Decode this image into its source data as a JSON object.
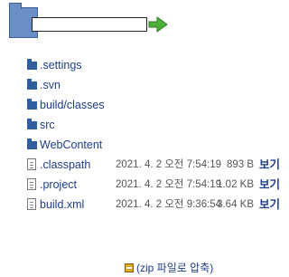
{
  "path": {
    "value": ""
  },
  "entries": [
    {
      "type": "folder",
      "name": ".settings"
    },
    {
      "type": "folder",
      "name": ".svn"
    },
    {
      "type": "folder",
      "name": "build/classes"
    },
    {
      "type": "folder",
      "name": "src"
    },
    {
      "type": "folder",
      "name": "WebContent"
    },
    {
      "type": "file",
      "name": ".classpath",
      "date": "2021. 4. 2 오전 7:54:19",
      "size": "893 B",
      "view": "보기"
    },
    {
      "type": "file",
      "name": ".project",
      "date": "2021. 4. 2 오전 7:54:19",
      "size": "1.02 KB",
      "view": "보기"
    },
    {
      "type": "file",
      "name": "build.xml",
      "date": "2021. 4. 2 오전 9:36:54",
      "size": "3.64 KB",
      "view": "보기"
    }
  ],
  "zip": {
    "label": "(zip 파일로 압축)"
  },
  "colors": {
    "link": "#1e3d8a",
    "folder": "#2f5f9e",
    "arrow": "#4caf3a"
  }
}
